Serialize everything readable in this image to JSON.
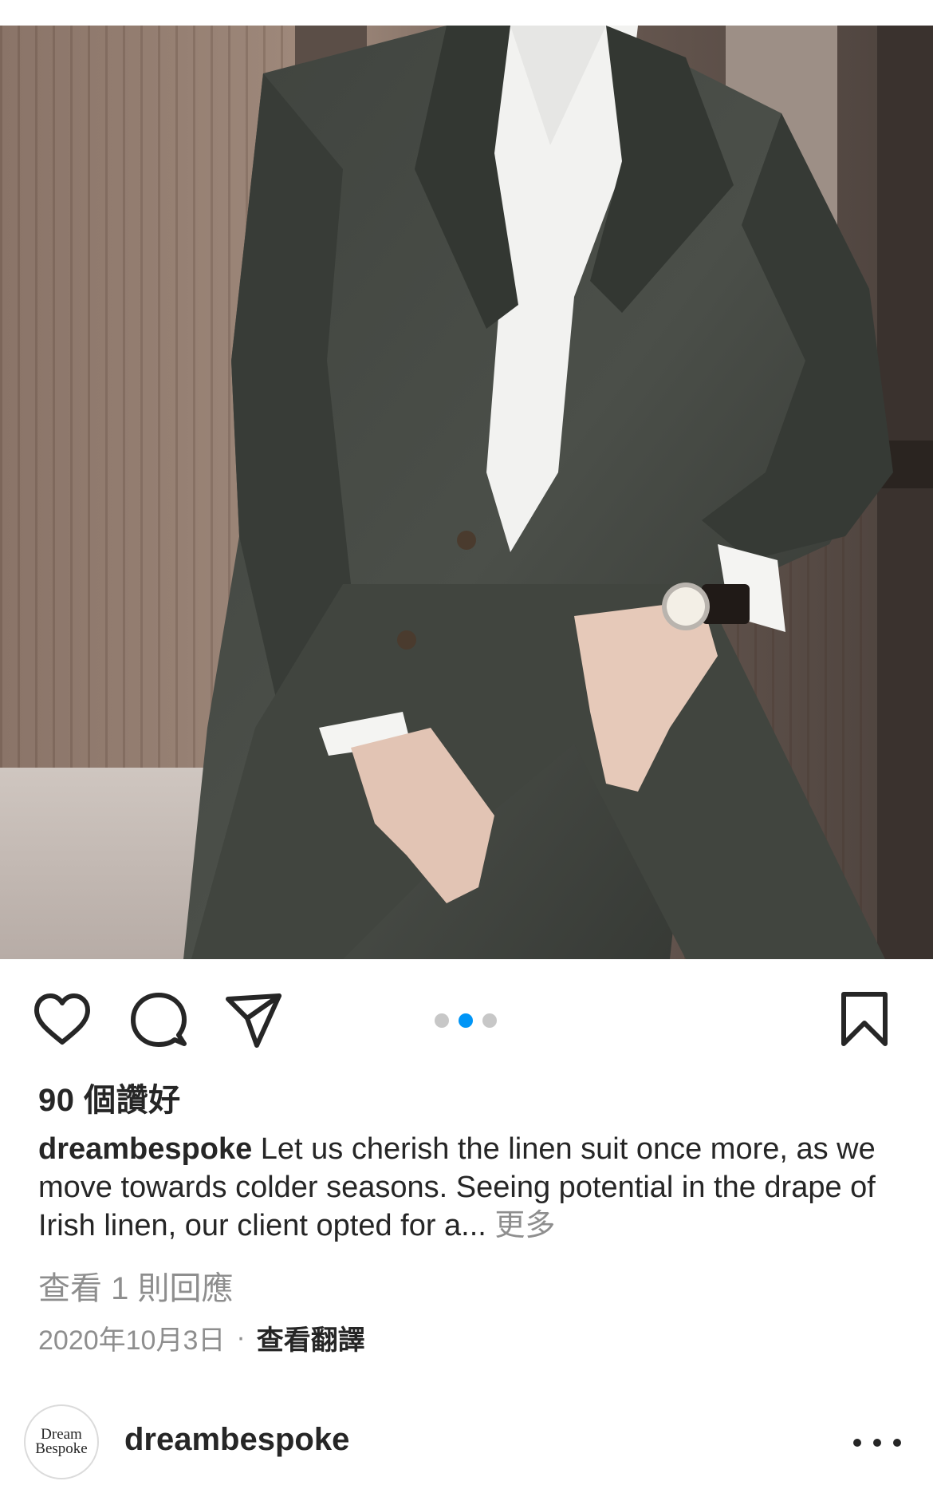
{
  "post": {
    "image_icon": "photo-linen-suit",
    "carousel": {
      "count": 3,
      "active_index": 1
    }
  },
  "actions": {
    "like_icon": "heart-outline-icon",
    "comment_icon": "speech-bubble-icon",
    "share_icon": "paper-plane-icon",
    "save_icon": "bookmark-outline-icon"
  },
  "likes": {
    "text": "90 個讚好"
  },
  "caption": {
    "username": "dreambespoke",
    "text": " Let us cherish the linen suit once more, as we move towards colder seasons. Seeing potential in the drape of Irish linen, our client opted for a... ",
    "more_label": "更多"
  },
  "comments": {
    "view_label": "查看 1 則回應"
  },
  "meta": {
    "date": "2020年10月3日",
    "separator": "·",
    "translate_label": "查看翻譯"
  },
  "next_post": {
    "avatar_line1": "Dream",
    "avatar_line2": "Bespoke",
    "username": "dreambespoke",
    "options_icon": "ellipsis-icon"
  },
  "colors": {
    "text_primary": "#262626",
    "text_secondary": "#8e8e8e",
    "carousel_active": "#0095f6",
    "carousel_inactive": "#c7c7c7"
  }
}
